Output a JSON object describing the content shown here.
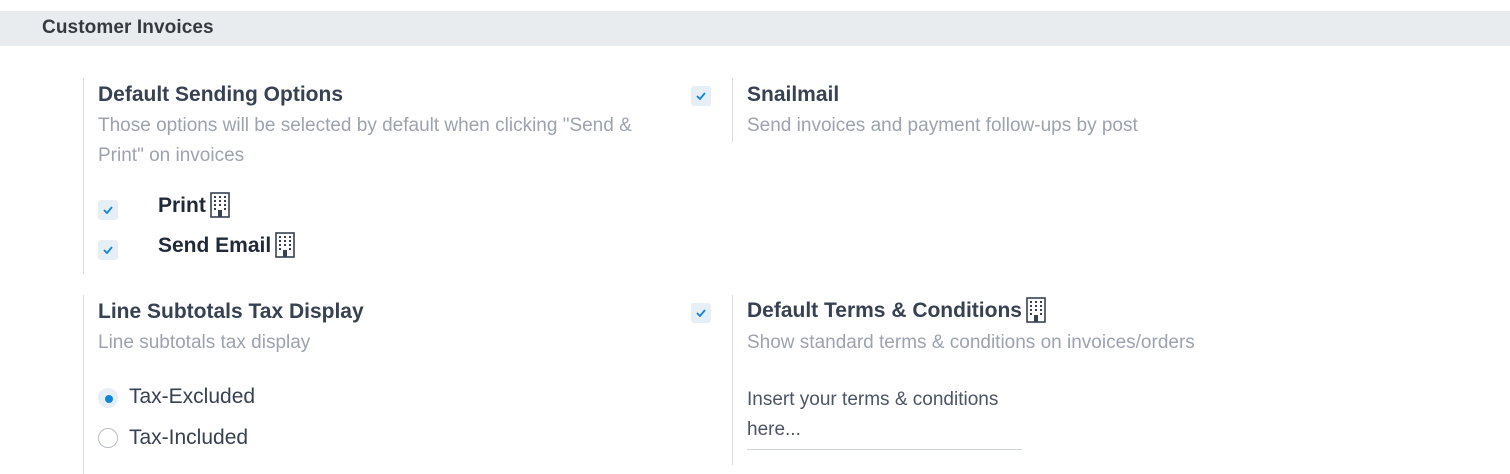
{
  "section": {
    "title": "Customer Invoices"
  },
  "default_sending_options": {
    "title": "Default Sending Options",
    "description": "Those options will be selected by default when clicking \"Send & Print\" on invoices",
    "options": [
      {
        "label": "Print",
        "checked": true
      },
      {
        "label": "Send Email",
        "checked": true
      }
    ]
  },
  "snailmail": {
    "title": "Snailmail",
    "description": "Send invoices and payment follow-ups by post",
    "checked": true
  },
  "line_subtotals": {
    "title": "Line Subtotals Tax Display",
    "description": "Line subtotals tax display",
    "options": [
      {
        "label": "Tax-Excluded",
        "selected": true
      },
      {
        "label": "Tax-Included",
        "selected": false
      }
    ]
  },
  "default_terms": {
    "title": "Default Terms & Conditions",
    "description": "Show standard terms & conditions on invoices/orders",
    "checked": true,
    "input_placeholder": "Insert your terms & conditions here..."
  },
  "colors": {
    "accent": "#0f86d6",
    "header_bg": "#e9ecef",
    "muted_text": "#9ca3af"
  },
  "icons": {
    "company": "company-building-icon",
    "check": "checkmark-icon"
  }
}
